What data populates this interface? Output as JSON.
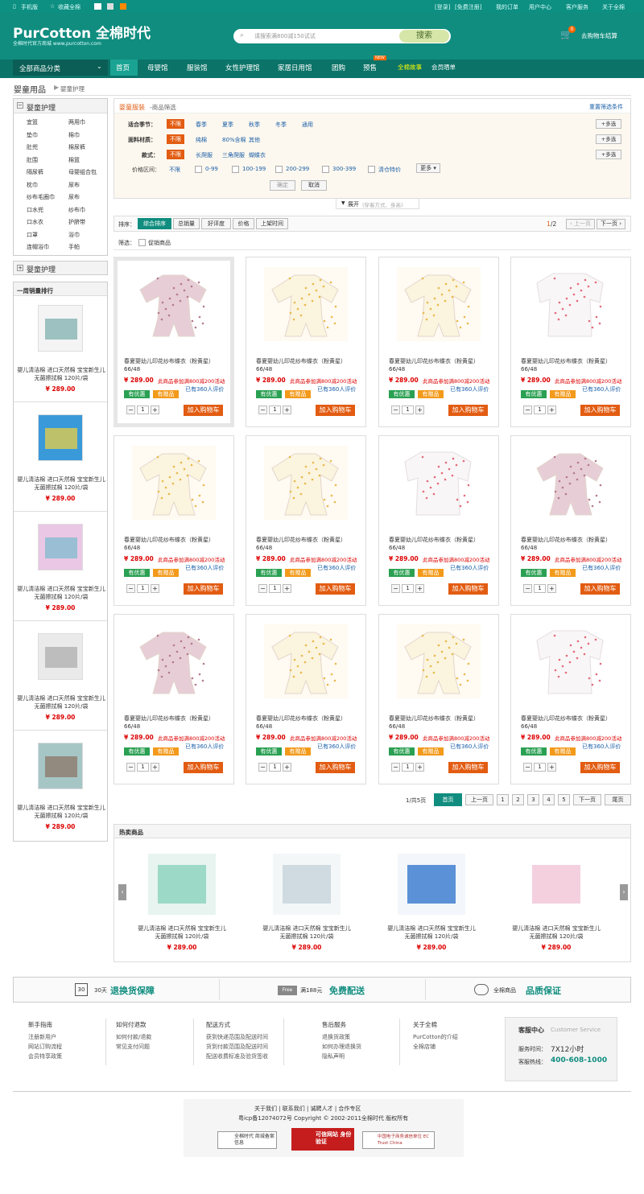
{
  "topbar": {
    "left": [
      "手机版",
      "收藏全棉"
    ],
    "right": [
      "[登录]",
      "[免费注册]",
      "我的订单",
      "用户中心",
      "客户服务",
      "关于全棉"
    ]
  },
  "header": {
    "logo": "PurCotton 全棉时代",
    "slogan": "全棉时代官方商城 www.purcotton.com",
    "search_placeholder": "请搜索满800减150试试",
    "search_button": "搜索",
    "cart_count": "0",
    "cart_label": "去购物车结算"
  },
  "nav": {
    "category": "全部商品分类",
    "items": [
      "首页",
      "母婴馆",
      "服装馆",
      "女性护理馆",
      "家居日用馆",
      "团购",
      "预售",
      "全棉故事",
      "会员晒单"
    ],
    "new_badge": "NEW"
  },
  "breadcrumb": {
    "root": "婴童用品",
    "current": "婴童护理"
  },
  "sidebar": {
    "title": "婴童护理",
    "items": [
      [
        "宜篮",
        "两用巾"
      ],
      [
        "垫巾",
        "棉巾"
      ],
      [
        "肚兜",
        "棉尿裤"
      ],
      [
        "肚围",
        "棉篮"
      ],
      [
        "隔尿裤",
        "母婴组合包"
      ],
      [
        "枕巾",
        "尿布"
      ],
      [
        "纱布毛圈巾",
        "尿布"
      ],
      [
        "口水兜",
        "纱布巾"
      ],
      [
        "口水衣",
        "护脐带"
      ],
      [
        "口罩",
        "浴巾"
      ],
      [
        "连帽浴巾",
        "手帕"
      ]
    ],
    "title2": "婴童护理",
    "rank_title": "一周销量排行",
    "rank_items": [
      {
        "name": "婴儿清洁棉 进口天然棉 宝宝新生儿无菌擦拭棉 120片/袋",
        "price": "¥ 289.00"
      },
      {
        "name": "婴儿清洁棉 进口天然棉 宝宝新生儿无菌擦拭棉 120片/袋",
        "price": "¥ 289.00"
      },
      {
        "name": "婴儿清洁棉 进口天然棉 宝宝新生儿无菌擦拭棉 120片/袋",
        "price": "¥ 289.00"
      },
      {
        "name": "婴儿清洁棉 进口天然棉 宝宝新生儿无菌擦拭棉 120片/袋",
        "price": "¥ 289.00"
      },
      {
        "name": "婴儿清洁棉 进口天然棉 宝宝新生儿无菌擦拭棉 120片/袋",
        "price": "¥ 289.00"
      }
    ]
  },
  "filter": {
    "title": "婴童服装",
    "subtitle": "-商品筛选",
    "reset": "重置筛选条件",
    "rows": [
      {
        "label": "适合季节：",
        "selected": "不限",
        "options": [
          "春季",
          "夏季",
          "秋季",
          "冬季",
          "通用"
        ],
        "more": "+多选"
      },
      {
        "label": "面料材质：",
        "selected": "不限",
        "options": [
          "纯棉",
          "80%含棉",
          "其他"
        ],
        "more": "+多选"
      },
      {
        "label": "款式：",
        "selected": "不限",
        "options": [
          "长爬服",
          "三角爬服",
          "蝴蝶衣"
        ],
        "more": "+多选"
      }
    ],
    "price_label": "价格区间：",
    "price_options": [
      "不限",
      "0-99",
      "100-199",
      "200-299",
      "300-399",
      "清仓特价"
    ],
    "price_more": "更多",
    "confirm": "确定",
    "cancel": "取消",
    "expand": "展开",
    "expand_hint": "(穿着方式、身高)"
  },
  "sort": {
    "label": "排序：",
    "options": [
      "综合排序",
      "总销量",
      "好评度",
      "价格",
      "上架时间"
    ],
    "page": "1",
    "total": "/2",
    "prev": "上一页",
    "next": "下一页",
    "filter_label": "筛选：",
    "promo": "促销商品"
  },
  "product": {
    "name": "春夏婴幼儿印花纱布蝶衣（粉黄星）66/48",
    "price": "¥ 289.00",
    "promo": "此商品参加满800减200活动",
    "reviews": "已有360人评价",
    "tag1": "有优惠",
    "tag2": "有赠品",
    "qty": "1",
    "add": "加入购物车"
  },
  "products": [
    "pink",
    "yellow",
    "yellow",
    "white",
    "yellow",
    "yellow",
    "white",
    "pink",
    "pink",
    "yellow",
    "yellow",
    "white"
  ],
  "pagination": {
    "info": "1/共5页",
    "first": "首页",
    "prev": "上一页",
    "pages": [
      "1",
      "2",
      "3",
      "4",
      "5"
    ],
    "next": "下一页",
    "last": "尾页"
  },
  "hot": {
    "title": "热卖商品",
    "items": [
      {
        "name": "婴儿清洁棉 进口天然棉 宝宝新生儿无菌擦拭棉 120片/袋",
        "price": "¥ 289.00"
      },
      {
        "name": "婴儿清洁棉 进口天然棉 宝宝新生儿无菌擦拭棉 120片/袋",
        "price": "¥ 289.00"
      },
      {
        "name": "婴儿清洁棉 进口天然棉 宝宝新生儿无菌擦拭棉 120片/袋",
        "price": "¥ 289.00"
      },
      {
        "name": "婴儿清洁棉 进口天然棉 宝宝新生儿无菌擦拭棉 120片/袋",
        "price": "¥ 289.00"
      }
    ]
  },
  "guarantee": [
    {
      "icon": "30",
      "small": "30天",
      "big": "退换货保障"
    },
    {
      "icon": "Free",
      "small": "满188元",
      "big": "免费配送"
    },
    {
      "icon": "",
      "small": "全棉商品",
      "big": "品质保证"
    }
  ],
  "footer_cols": [
    {
      "title": "新手指南",
      "links": [
        "注册新用户",
        "网站订购流程",
        "会员特享政策"
      ]
    },
    {
      "title": "如何付退款",
      "links": [
        "如何付款/退款",
        "常见支付问题"
      ]
    },
    {
      "title": "配送方式",
      "links": [
        "获到快递范围及配送时间",
        "货到付款范围及配送时间",
        "配送收费标准及验货签收"
      ]
    },
    {
      "title": "售后服务",
      "links": [
        "退换货政策",
        "如何办理退换货",
        "隐私声明"
      ]
    },
    {
      "title": "关于全棉",
      "links": [
        "PurCotton的介绍",
        "全棉店铺"
      ]
    }
  ],
  "service": {
    "title": "客服中心",
    "title_en": "Customer Service",
    "time_label": "服务时间：",
    "time": "7X12小时",
    "hotline_label": "客服热线：",
    "hotline": "400-608-1000"
  },
  "bottom": {
    "links": "关于我们  |  联系我们  |  诚聘人才  |  合作专区",
    "icp": "粤icp备12074072号 Copyright © 2002-2011全棉时代 版权所有",
    "badge1": "全棉时代 商城备案信息",
    "badge2": "可信网站 身份验证",
    "badge3": "中国电子商务诚信单位 EC Trust China"
  },
  "colors": {
    "primary": "#108d7f",
    "dark": "#0b7368",
    "price": "#dd0000",
    "button": "#e25c12"
  }
}
